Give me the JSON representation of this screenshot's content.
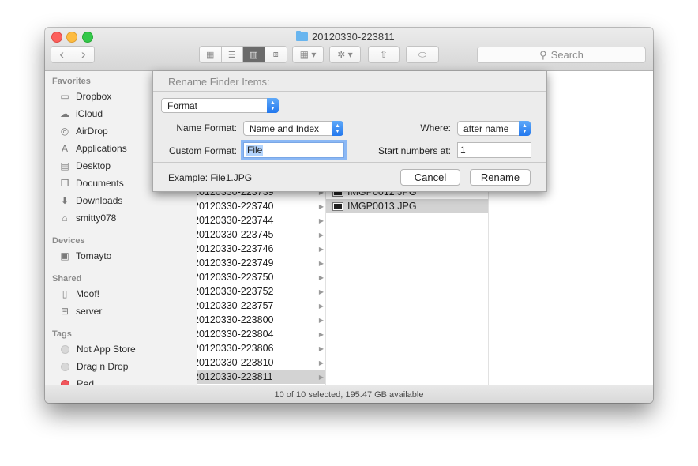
{
  "window": {
    "title": "20120330-223811",
    "icons": {
      "close": "close-dot",
      "minimize": "minimize-dot",
      "zoom": "zoom-dot",
      "title_folder": "folder-icon"
    }
  },
  "toolbar": {
    "back_glyph": "‹",
    "forward_glyph": "›",
    "view_modes": [
      {
        "name": "icon-view",
        "glyph": "▦",
        "selected": false
      },
      {
        "name": "list-view",
        "glyph": "☰",
        "selected": false
      },
      {
        "name": "column-view",
        "glyph": "▥",
        "selected": true
      },
      {
        "name": "coverflow-view",
        "glyph": "⧈",
        "selected": false
      }
    ],
    "arrange_glyph": "▦ ▾",
    "action_glyph": "✲ ▾",
    "share_glyph": "⇧",
    "tag_glyph": "⬭",
    "search_glyph": "⚲",
    "search_placeholder": "Search"
  },
  "sidebar": {
    "favorites_heading": "Favorites",
    "favorites": [
      {
        "label": "Dropbox",
        "icon": "folder-icon",
        "glyph": "▭"
      },
      {
        "label": "iCloud",
        "icon": "cloud-icon",
        "glyph": "☁"
      },
      {
        "label": "AirDrop",
        "icon": "airdrop-icon",
        "glyph": "◎"
      },
      {
        "label": "Applications",
        "icon": "applications-icon",
        "glyph": "A"
      },
      {
        "label": "Desktop",
        "icon": "desktop-icon",
        "glyph": "▤"
      },
      {
        "label": "Documents",
        "icon": "documents-icon",
        "glyph": "❐"
      },
      {
        "label": "Downloads",
        "icon": "downloads-icon",
        "glyph": "⬇"
      },
      {
        "label": "smitty078",
        "icon": "home-icon",
        "glyph": "⌂"
      }
    ],
    "devices_heading": "Devices",
    "devices": [
      {
        "label": "Tomayto",
        "icon": "hard-drive-icon",
        "glyph": "▣"
      }
    ],
    "shared_heading": "Shared",
    "shared": [
      {
        "label": "Moof!",
        "icon": "server-tower-icon",
        "glyph": "▯"
      },
      {
        "label": "server",
        "icon": "server-icon",
        "glyph": "⊟"
      }
    ],
    "tags_heading": "Tags",
    "tags": [
      {
        "label": "Not App Store",
        "color": "#d8d8d8"
      },
      {
        "label": "Drag n Drop",
        "color": "#d8d8d8"
      },
      {
        "label": "Red",
        "color": "#f0555b"
      }
    ]
  },
  "column1": {
    "arrow_glyph": "▶",
    "rows": [
      {
        "label": "20120330-223739",
        "selected": false
      },
      {
        "label": "20120330-223740",
        "selected": false
      },
      {
        "label": "20120330-223744",
        "selected": false
      },
      {
        "label": "20120330-223745",
        "selected": false
      },
      {
        "label": "20120330-223746",
        "selected": false
      },
      {
        "label": "20120330-223749",
        "selected": false
      },
      {
        "label": "20120330-223750",
        "selected": false
      },
      {
        "label": "20120330-223752",
        "selected": false
      },
      {
        "label": "20120330-223757",
        "selected": false
      },
      {
        "label": "20120330-223800",
        "selected": false
      },
      {
        "label": "20120330-223804",
        "selected": false
      },
      {
        "label": "20120330-223806",
        "selected": false
      },
      {
        "label": "20120330-223810",
        "selected": false
      },
      {
        "label": "20120330-223811",
        "selected": true
      }
    ]
  },
  "column2": {
    "rows": [
      {
        "label": "IMGP0012.JPG",
        "selected": false
      },
      {
        "label": "IMGP0013.JPG",
        "selected": true
      }
    ]
  },
  "status": {
    "text": "10 of 10 selected, 195.47 GB available"
  },
  "rename_sheet": {
    "title": "Rename Finder Items:",
    "mode": "Format",
    "name_format_label": "Name Format:",
    "name_format_value": "Name and Index",
    "where_label": "Where:",
    "where_value": "after name",
    "custom_format_label": "Custom Format:",
    "custom_format_value": "File",
    "start_numbers_label": "Start numbers at:",
    "start_numbers_value": "1",
    "example_text": "Example: File1.JPG",
    "cancel_label": "Cancel",
    "rename_label": "Rename",
    "stepper_glyph_up": "▲",
    "stepper_glyph_down": "▼"
  }
}
